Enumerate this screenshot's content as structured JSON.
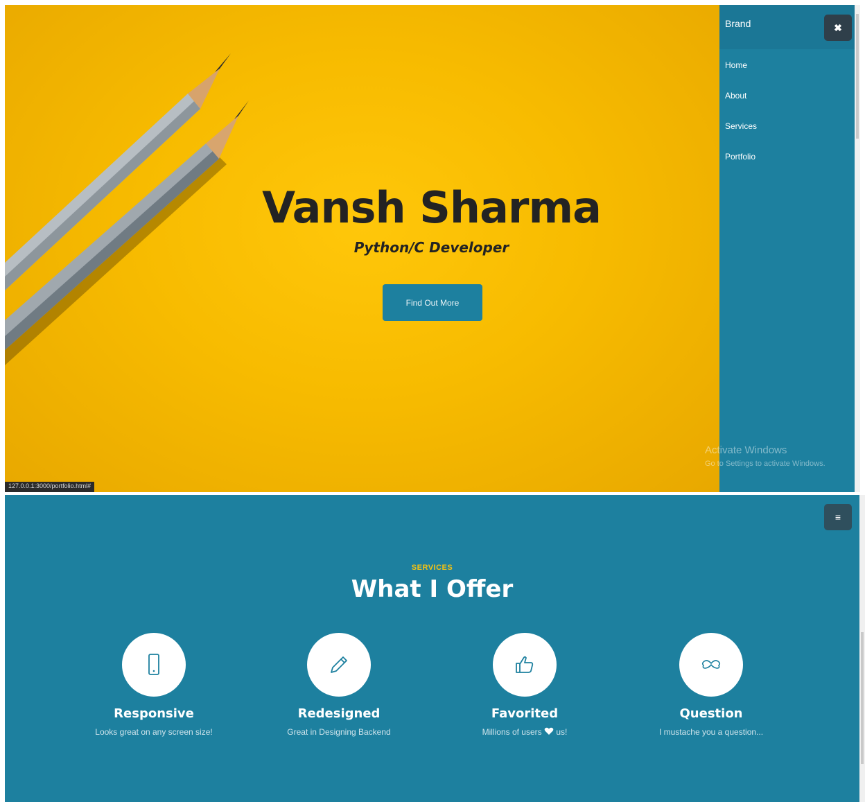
{
  "hero": {
    "title": "Vansh Sharma",
    "subtitle": "Python/C Developer",
    "cta_label": "Find Out More"
  },
  "side_nav": {
    "brand": "Brand",
    "close_icon": "close-icon",
    "items": [
      {
        "label": "Home"
      },
      {
        "label": "About"
      },
      {
        "label": "Services"
      },
      {
        "label": "Portfolio"
      }
    ]
  },
  "system": {
    "watermark_line1": "Activate Windows",
    "watermark_line2": "Go to Settings to activate Windows.",
    "status_url": "127.0.0.1:3000/portfolio.html#"
  },
  "services": {
    "eyebrow": "SERVICES",
    "title": "What I Offer",
    "menu_icon": "hamburger-menu-icon",
    "items": [
      {
        "icon": "phone-icon",
        "title": "Responsive",
        "text": "Looks great on any screen size!"
      },
      {
        "icon": "pencil-icon",
        "title": "Redesigned",
        "text": "Great in  Designing Backend"
      },
      {
        "icon": "thumbs-up-icon",
        "title": "Favorited",
        "text_before": "Millions of users",
        "text_icon": "heart-icon",
        "text_after": "us!"
      },
      {
        "icon": "mustache-icon",
        "title": "Question",
        "text": "I mustache you a question..."
      }
    ]
  },
  "colors": {
    "primary": "#1d809f",
    "accent": "#f5c211",
    "hero_bg": "#f7bb00",
    "dark_button": "#2f3f4a"
  }
}
